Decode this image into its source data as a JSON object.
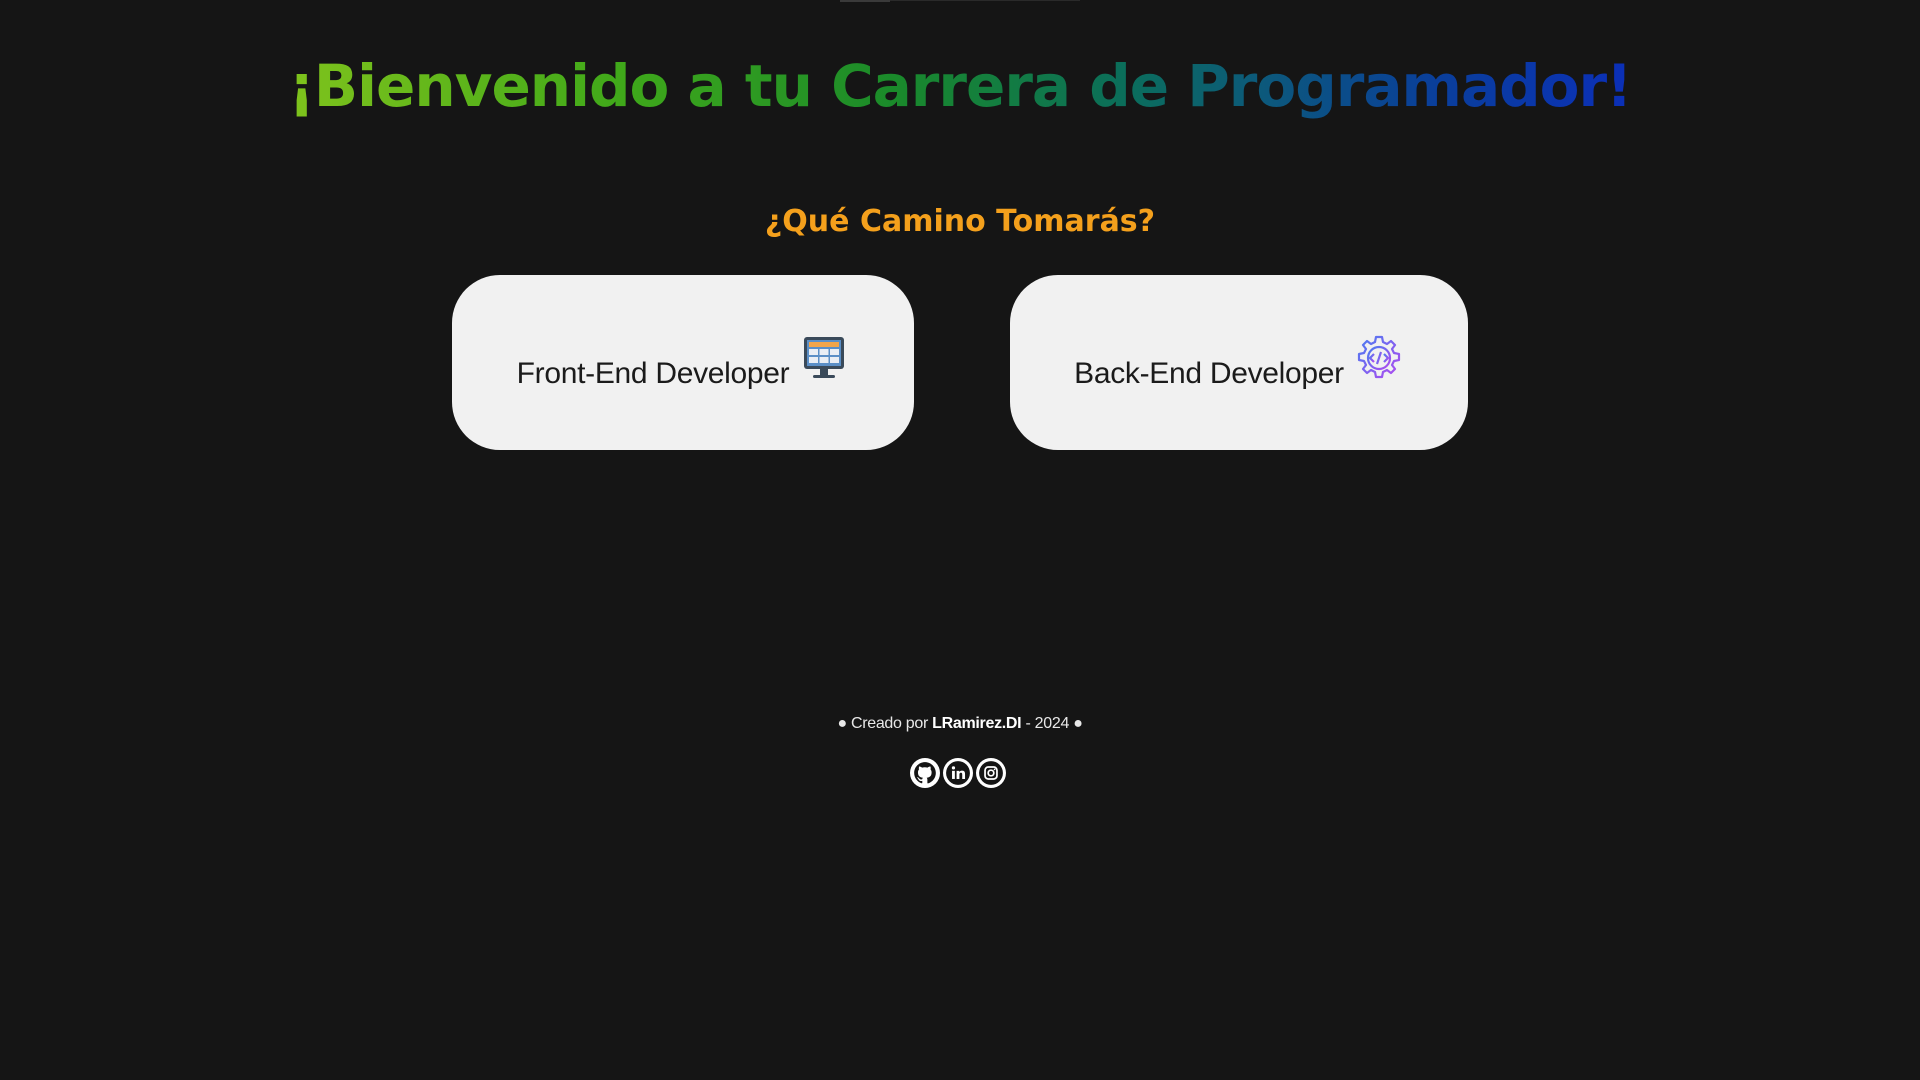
{
  "header": {
    "title": "¡Bienvenido a tu Carrera de Programador!",
    "subtitle": "¿Qué Camino Tomarás?"
  },
  "paths": [
    {
      "label": "Front-End Developer",
      "icon": "monitor-icon"
    },
    {
      "label": "Back-End Developer",
      "icon": "code-gear-icon"
    }
  ],
  "footer": {
    "prefix": "● Creado por",
    "author": "LRamirez.DI",
    "suffix": "- 2024 ●",
    "socials": [
      {
        "icon": "github-icon"
      },
      {
        "icon": "linkedin-icon"
      },
      {
        "icon": "instagram-icon"
      }
    ]
  },
  "colors": {
    "background": "#151515",
    "subtitle": "#f4a01c",
    "card": "#f1f1f1",
    "title_gradient": [
      "#7fc31c",
      "#1a8a2a",
      "#0c5a7a",
      "#0b2fb8"
    ]
  }
}
